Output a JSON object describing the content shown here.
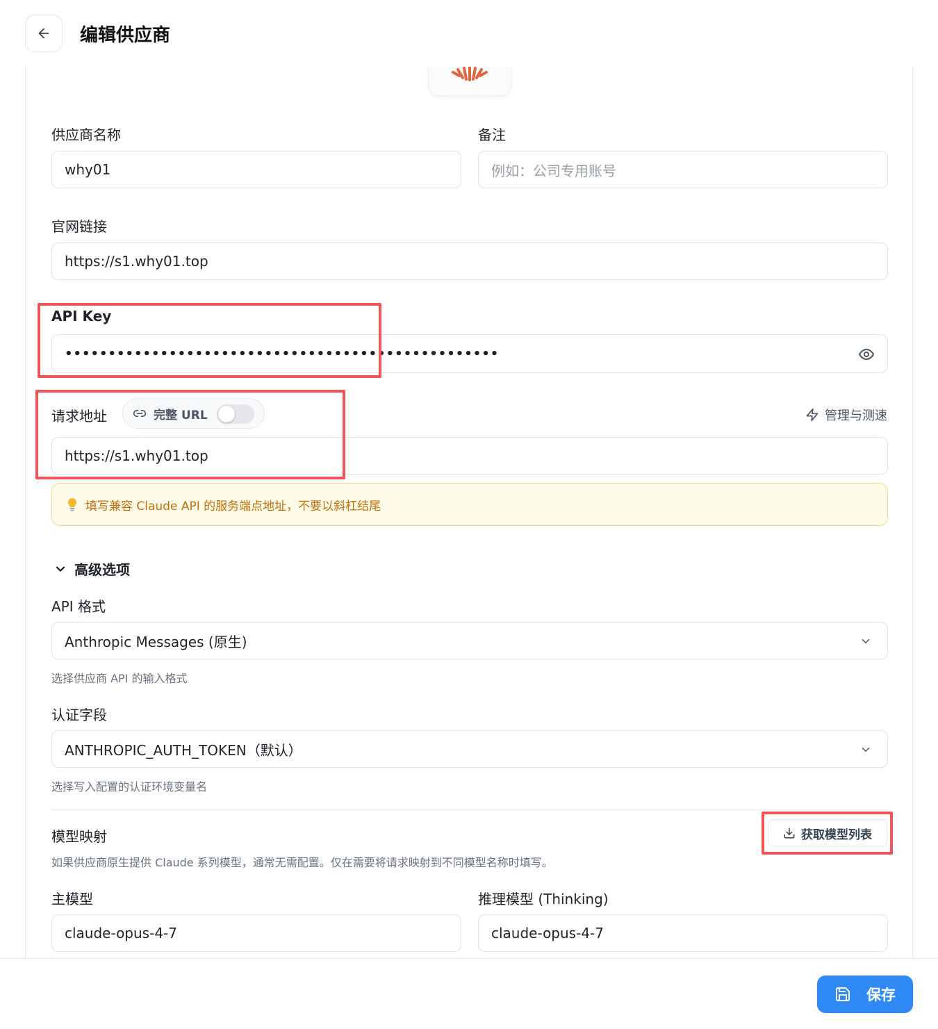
{
  "header": {
    "title": "编辑供应商"
  },
  "form": {
    "name": {
      "label": "供应商名称",
      "value": "why01"
    },
    "note": {
      "label": "备注",
      "placeholder": "例如：公司专用账号"
    },
    "website": {
      "label": "官网链接",
      "value": "https://s1.why01.top"
    },
    "api_key": {
      "label": "API Key",
      "masked_value": "••••••••••••••••••••••••••••••••••••••••••••••••••"
    },
    "endpoint": {
      "label": "请求地址",
      "toggle_label": "完整 URL",
      "toggle_on": false,
      "manage_label": "管理与测速",
      "value": "https://s1.why01.top",
      "notice": "填写兼容 Claude API 的服务端点地址，不要以斜杠结尾"
    }
  },
  "advanced": {
    "title": "高级选项",
    "api_format": {
      "label": "API 格式",
      "value": "Anthropic Messages (原生)",
      "hint": "选择供应商 API 的输入格式"
    },
    "auth_field": {
      "label": "认证字段",
      "value": "ANTHROPIC_AUTH_TOKEN（默认）",
      "hint": "选择写入配置的认证环境变量名"
    },
    "model_mapping": {
      "title": "模型映射",
      "fetch_label": "获取模型列表",
      "description": "如果供应商原生提供 Claude 系列模型，通常无需配置。仅在需要将请求映射到不同模型名称时填写。",
      "main_model": {
        "label": "主模型",
        "value": "claude-opus-4-7"
      },
      "thinking_model": {
        "label": "推理模型 (Thinking)",
        "value": "claude-opus-4-7"
      }
    }
  },
  "footer": {
    "save_label": "保存"
  },
  "colors": {
    "accent": "#2f8af5",
    "highlight": "#f0555a",
    "notice_text": "#c2700c",
    "logo": "#e0663f"
  }
}
